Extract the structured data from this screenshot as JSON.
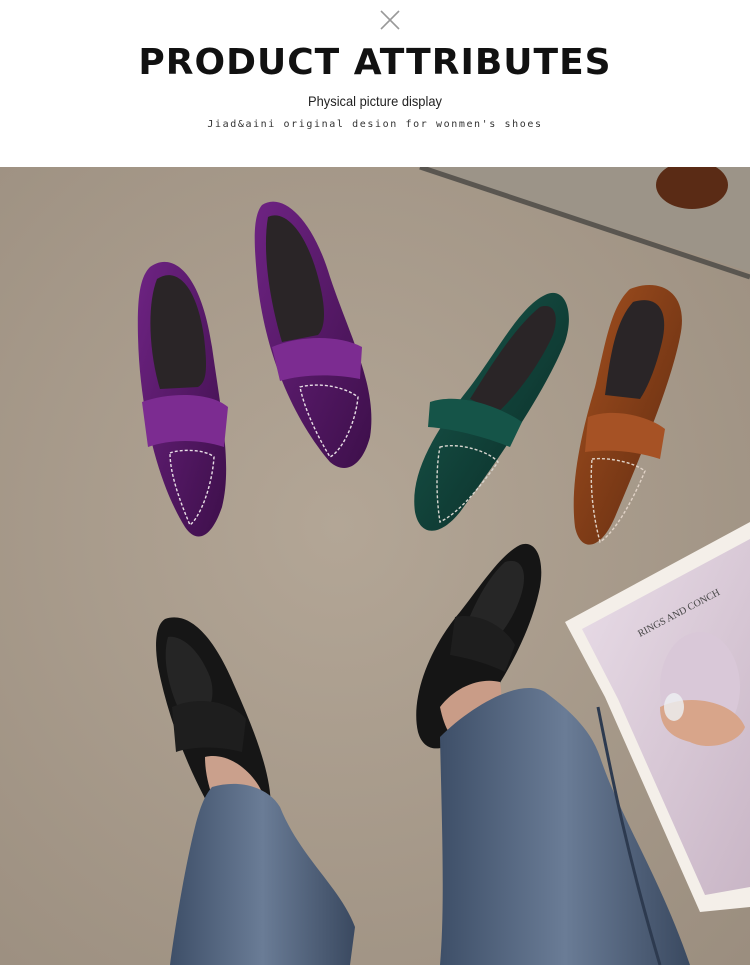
{
  "header": {
    "close_icon": "close-icon",
    "title": "PRODUCT ATTRIBUTES",
    "subtitle": "Physical picture display",
    "tagline": "Jiad&aini original desion for wonmen's shoes"
  },
  "photo": {
    "magazine_text": "RINGS AND CONCH",
    "colors": {
      "floor": "#a99c8d",
      "purple": "#5c1a6e",
      "green": "#0f3d35",
      "brown": "#8a3f1a",
      "black": "#151515",
      "denim": "#4a5a72"
    }
  }
}
